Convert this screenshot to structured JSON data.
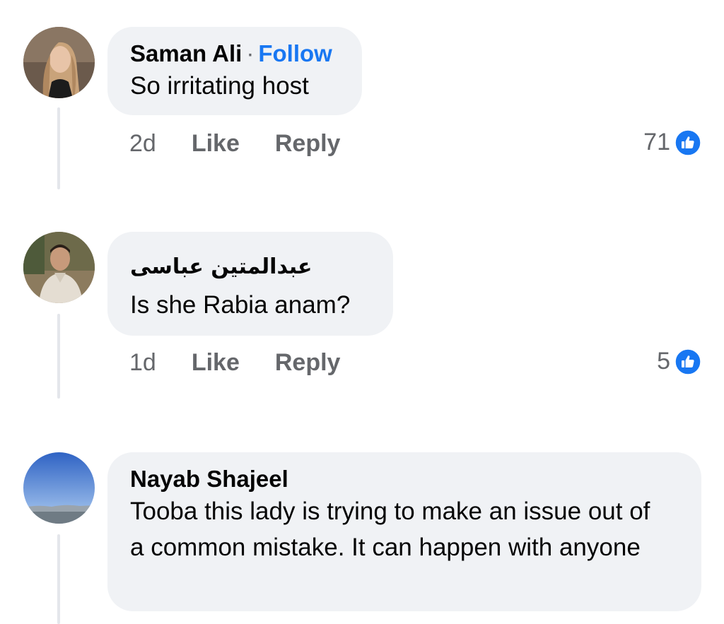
{
  "comments": [
    {
      "author": "Saman Ali",
      "follow_label": "Follow",
      "separator": "·",
      "text": "So irritating host",
      "time": "2d",
      "like_label": "Like",
      "reply_label": "Reply",
      "reaction_count": "71"
    },
    {
      "author": "عبدالمتین عباسی",
      "text": "Is she Rabia anam?",
      "time": "1d",
      "like_label": "Like",
      "reply_label": "Reply",
      "reaction_count": "5"
    },
    {
      "author": "Nayab Shajeel",
      "text": "Tooba this lady is trying to make an issue out of a common mistake. It can happen with anyone"
    }
  ],
  "colors": {
    "bubble": "#f0f2f5",
    "meta_text": "#65676b",
    "follow_link": "#1877f2",
    "like_reaction": "#1877f2"
  }
}
